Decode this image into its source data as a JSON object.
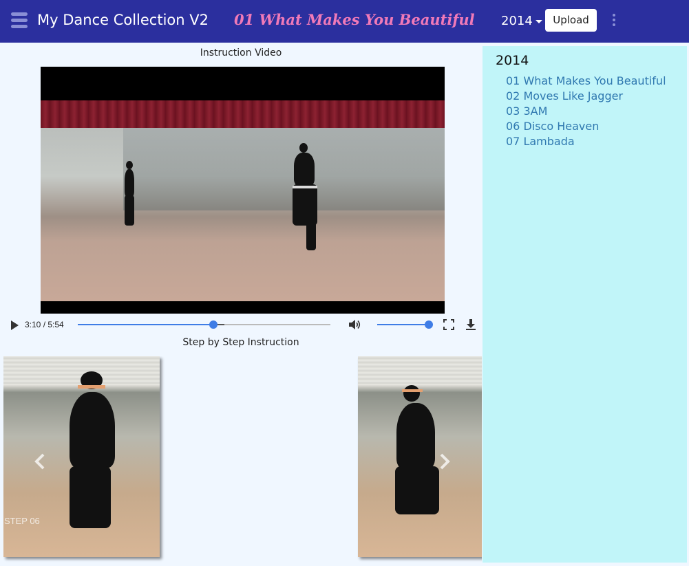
{
  "header": {
    "app_title": "My Dance Collection V2",
    "current_song": "01 What Makes You Beautiful",
    "year_selected": "2014",
    "upload_label": "Upload"
  },
  "main": {
    "video_heading": "Instruction Video",
    "player": {
      "time": "3:10 / 5:54",
      "progress": 0.537,
      "buffered_end": 0.58,
      "volume": 1.0
    },
    "steps_heading": "Step by Step Instruction",
    "carousel": {
      "current_step_label": "STEP 06"
    }
  },
  "sidebar": {
    "year": "2014",
    "songs": [
      "01 What Makes You Beautiful",
      "02 Moves Like Jagger",
      "03 3AM",
      "06 Disco Heaven",
      "07 Lambada"
    ]
  },
  "colors": {
    "header_bg": "#2b2f9e",
    "song_title": "#f07ab8",
    "sidebar_bg": "#c1f5f9",
    "link": "#2f78b0",
    "player_accent": "#3f7de6"
  },
  "icons": {
    "menu": "hamburger-menu-icon",
    "more": "kebab-more-icon",
    "play": "play-icon",
    "volume": "volume-icon",
    "fullscreen": "fullscreen-icon",
    "download": "download-icon",
    "prev": "chevron-left-icon",
    "next": "chevron-right-icon"
  }
}
